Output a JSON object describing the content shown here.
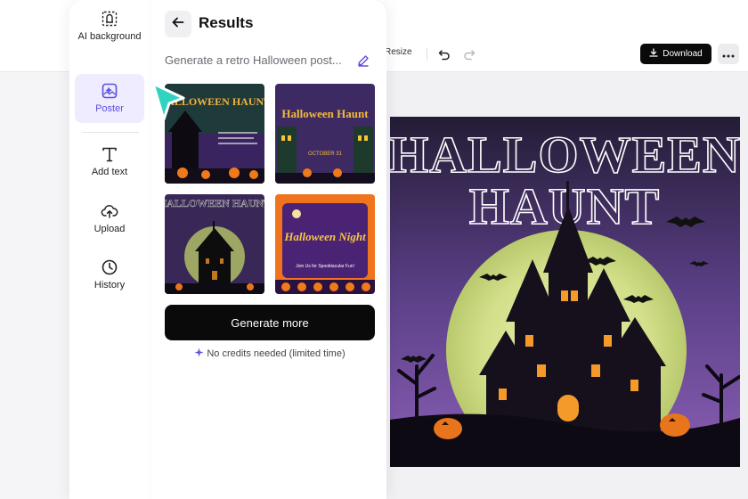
{
  "rail": {
    "items": [
      {
        "label": "AI background",
        "icon": "ai-background-icon"
      },
      {
        "label": "Poster",
        "icon": "poster-icon",
        "active": true
      },
      {
        "label": "Add text",
        "icon": "text-icon"
      },
      {
        "label": "Upload",
        "icon": "upload-icon"
      },
      {
        "label": "History",
        "icon": "history-icon"
      }
    ]
  },
  "panel": {
    "title": "Results",
    "prompt": "Generate a retro Halloween post...",
    "thumbnails": [
      {
        "title": "HALLOWEEN HAUNT",
        "selected": false
      },
      {
        "title": "Halloween Haunt",
        "subtitle": "OCTOBER 31",
        "selected": false
      },
      {
        "title": "HALLOWEEN HAUNT",
        "selected": true
      },
      {
        "title": "Halloween Night",
        "subtitle": "Join Us for Spooktacular Fun!",
        "selected": false
      }
    ],
    "generate_label": "Generate more",
    "credits_note": "No credits needed (limited time)"
  },
  "toolbar": {
    "resize_label": "Resize",
    "download_label": "Download"
  },
  "poster": {
    "title_line1": "HALLOWEEN",
    "title_line2": "HAUNT"
  },
  "colors": {
    "accent": "#5b4fe0",
    "active_bg": "#efecff",
    "button_dark": "#0a0a0a",
    "cursor": "#2fd3c0"
  }
}
